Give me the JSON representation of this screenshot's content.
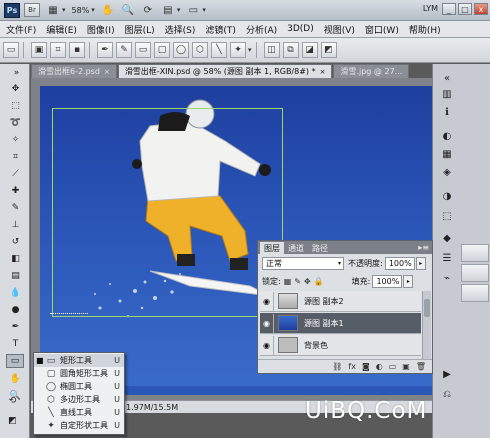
{
  "app": {
    "logo": "Ps",
    "btn_br": "Br",
    "zoom": "58%",
    "user": "LYM",
    "win_min": "_",
    "win_max": "□",
    "win_close": "x"
  },
  "menu": [
    "文件(F)",
    "编辑(E)",
    "图像(I)",
    "图层(L)",
    "选择(S)",
    "滤镜(T)",
    "分析(A)",
    "3D(D)",
    "视图(V)",
    "窗口(W)",
    "帮助(H)"
  ],
  "tabs": [
    {
      "label": "滑雪出框6-2.psd",
      "active": false
    },
    {
      "label": "滑雪出框-XIN.psd @ 58% (源图 副本 1, RGB/8#) *",
      "active": true
    },
    {
      "label": "滑雪.jpg @ 27...",
      "active": false
    }
  ],
  "status": {
    "doc": "1.97M/15.5M"
  },
  "layers_panel": {
    "tabs": [
      "图层",
      "通道",
      "路径"
    ],
    "blend_mode": "正常",
    "opacity_label": "不透明度:",
    "opacity": "100%",
    "lock_label": "锁定:",
    "fill_label": "填充:",
    "fill": "100%",
    "layers": [
      {
        "name": "源图 副本2",
        "selected": false
      },
      {
        "name": "源图 副本1",
        "selected": true
      },
      {
        "name": "背景色",
        "selected": false
      }
    ]
  },
  "flyout": [
    {
      "label": "矩形工具",
      "key": "U",
      "current": true
    },
    {
      "label": "圆角矩形工具",
      "key": "U",
      "current": false
    },
    {
      "label": "椭圆工具",
      "key": "U",
      "current": false
    },
    {
      "label": "多边形工具",
      "key": "U",
      "current": false
    },
    {
      "label": "直线工具",
      "key": "U",
      "current": false
    },
    {
      "label": "自定形状工具",
      "key": "U",
      "current": false
    }
  ],
  "watermark": "UiBQ.CoM",
  "colors": {
    "sky_top": "#1e3f9f",
    "sky_bottom": "#3a6ccb",
    "jacket": "#f2f2f0",
    "pants": "#f0b12a",
    "selection": "#9fd66a"
  }
}
